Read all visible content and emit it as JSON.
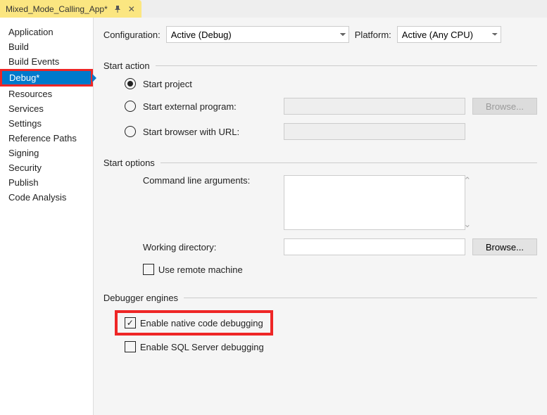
{
  "tab": {
    "title": "Mixed_Mode_Calling_App*",
    "pin_icon": "📌",
    "close_icon": "✕"
  },
  "sidebar": {
    "items": [
      {
        "label": "Application"
      },
      {
        "label": "Build"
      },
      {
        "label": "Build Events"
      },
      {
        "label": "Debug*",
        "selected": true
      },
      {
        "label": "Resources"
      },
      {
        "label": "Services"
      },
      {
        "label": "Settings"
      },
      {
        "label": "Reference Paths"
      },
      {
        "label": "Signing"
      },
      {
        "label": "Security"
      },
      {
        "label": "Publish"
      },
      {
        "label": "Code Analysis"
      }
    ]
  },
  "top": {
    "configuration_label": "Configuration:",
    "configuration_value": "Active (Debug)",
    "platform_label": "Platform:",
    "platform_value": "Active (Any CPU)"
  },
  "section_start_action": {
    "title": "Start action",
    "start_project": "Start project",
    "start_external": "Start external program:",
    "start_browser": "Start browser with URL:",
    "browse_btn": "Browse..."
  },
  "section_start_options": {
    "title": "Start options",
    "cmd_args": "Command line arguments:",
    "working_dir": "Working directory:",
    "use_remote": "Use remote machine",
    "browse_btn": "Browse..."
  },
  "section_debugger": {
    "title": "Debugger engines",
    "enable_native": "Enable native code debugging",
    "enable_sql": "Enable SQL Server debugging"
  }
}
